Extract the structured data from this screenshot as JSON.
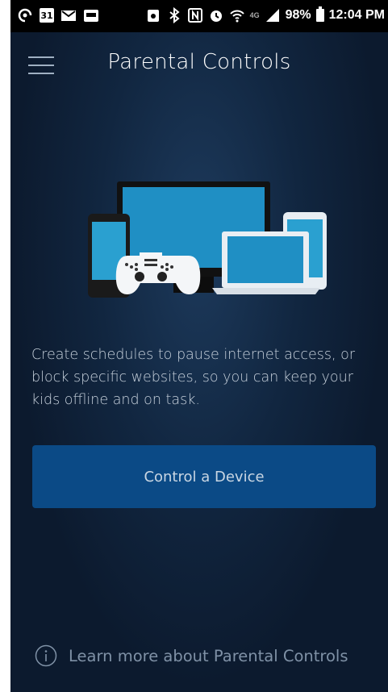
{
  "statusbar": {
    "battery": "98%",
    "time": "12:04 PM",
    "network": "4G",
    "left_icons": [
      "hotspot-icon",
      "calendar-icon",
      "mail-icon",
      "voicemail-icon"
    ],
    "calendar_day": "31",
    "right_icons": [
      "alarm-lock-icon",
      "bluetooth-icon",
      "nfc-icon",
      "alarm-icon",
      "wifi-icon",
      "signal-icon",
      "battery-icon"
    ]
  },
  "header": {
    "title": "Parental Controls",
    "menu_icon": "hamburger-icon"
  },
  "main": {
    "description": "Create schedules to pause internet access, or block specific websites, so you can keep your kids offline and on task.",
    "control_button": "Control a Device",
    "learn_more": "Learn more about Parental Controls"
  },
  "colors": {
    "background": "#0c1a2e",
    "button": "#0b4a86",
    "screen": "#1f8fc4"
  }
}
